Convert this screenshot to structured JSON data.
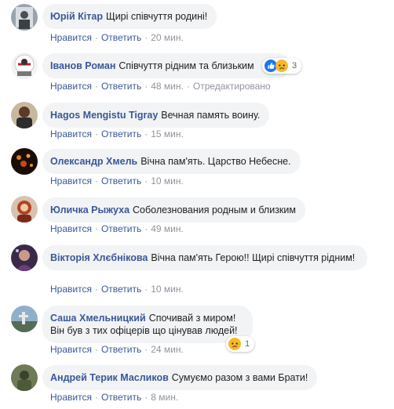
{
  "actions": {
    "like": "Нравится",
    "reply": "Ответить",
    "edited": "Отредактировано"
  },
  "comments": [
    {
      "author": "Юрій Кітар",
      "text": "Щирі співчуття родині!",
      "time": "20 мин."
    },
    {
      "author": "Іванов Роман",
      "text": "Співчуття рідним та близьким",
      "time": "48 мин.",
      "reactions": {
        "count": "3",
        "icons": [
          "like-icon",
          "sad-icon"
        ]
      }
    },
    {
      "author": "Hagos Mengistu Tigray",
      "text": "Вечная память воину.",
      "time": "15 мин."
    },
    {
      "author": "Олександр Хмель",
      "text": "Вічна пам'ять. Царство Небесне.",
      "time": "10 мин."
    },
    {
      "author": "Юличка Рыжуха",
      "text": "Соболезнования родным и близким",
      "time": "49 мин."
    },
    {
      "author": "Вікторія Хлєбнікова",
      "text": "Вічна пам'ять Герою!! Щирі співчуття рідним!",
      "time": "10 мин."
    },
    {
      "author": "Саша Хмельницкий",
      "text": "Спочивай з миром! Він був з тих офіцерів що цінував людей!",
      "time": "24 мин.",
      "reactions": {
        "count": "1",
        "icons": [
          "sad-icon"
        ]
      }
    },
    {
      "author": "Андрей Терик Масликов",
      "text": "Сумуємо разом з вами Брати!",
      "time": "8 мин."
    }
  ],
  "colors": {
    "link": "#385898",
    "bubble": "#f2f3f5",
    "meta": "#90949c",
    "like_blue": "#1877f2",
    "sad_yellow": "#f7b928"
  }
}
